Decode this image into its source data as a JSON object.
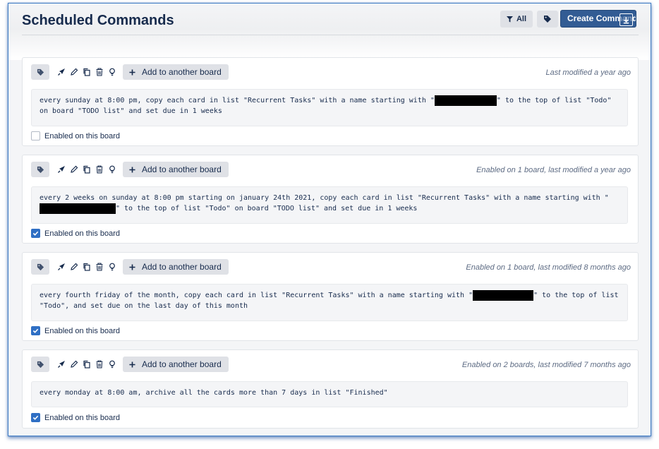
{
  "header": {
    "title": "Scheduled Commands",
    "all_label": "All",
    "create_label": "Create Command"
  },
  "colors": {
    "accent": "#325c94",
    "checkbox": "#2f6fc4",
    "text": "#172b4d",
    "muted": "#5e6c84"
  },
  "icons": [
    "tag-icon",
    "funnel-icon",
    "rocket-icon",
    "pencil-icon",
    "copy-icon",
    "trash-icon",
    "bulb-icon",
    "plus-icon",
    "check-icon",
    "download-icon"
  ],
  "commands": [
    {
      "add_label": "Add to another board",
      "meta": "Last modified a year ago",
      "text_a": "every sunday at 8:00 pm, copy each card in list \"Recurrent Tasks\" with a name starting with \"",
      "text_b": "\" to the top of list \"Todo\" on board \"TODO list\" and set due in 1 weeks",
      "enabled_label": "Enabled on this board",
      "enabled": false
    },
    {
      "add_label": "Add to another board",
      "meta": "Enabled on 1 board, last modified a year ago",
      "text_a": "every 2 weeks on sunday at 8:00 pm starting on january 24th 2021, copy each card in list \"Recurrent Tasks\" with a name starting with \"",
      "text_b": "\" to the top of list \"Todo\" on board \"TODO list\" and set due in 1 weeks",
      "enabled_label": "Enabled on this board",
      "enabled": true
    },
    {
      "add_label": "Add to another board",
      "meta": "Enabled on 1 board, last modified 8 months ago",
      "text_a": "every fourth friday of the month, copy each card in list \"Recurrent Tasks\" with a name starting with \"",
      "text_b": "\" to the top of list \"Todo\", and set due on the last day of this month",
      "enabled_label": "Enabled on this board",
      "enabled": true
    },
    {
      "add_label": "Add to another board",
      "meta": "Enabled on 2 boards, last modified 7 months ago",
      "text_a": "every monday at 8:00 am, archive all the cards more than 7 days in list \"Finished\"",
      "text_b": "",
      "enabled_label": "Enabled on this board",
      "enabled": true
    }
  ]
}
